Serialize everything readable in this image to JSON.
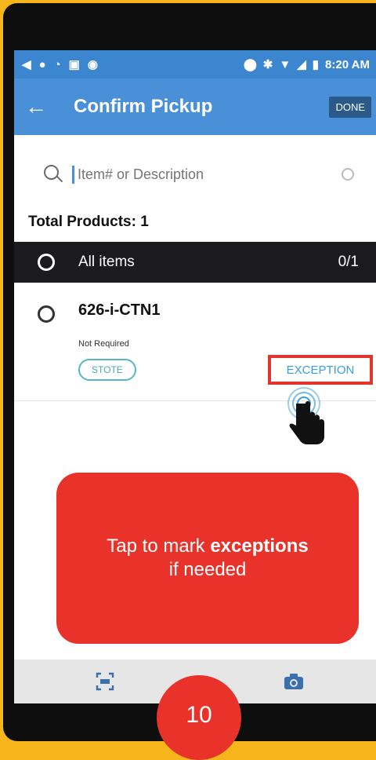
{
  "status_bar": {
    "time": "8:20 AM",
    "left_icons": [
      "back-triangle-icon",
      "circle-icon",
      "wifi-lock-icon",
      "image-icon",
      "sync-icon"
    ],
    "right_icons": [
      "location-pin-icon",
      "bluetooth-icon",
      "wifi-icon",
      "signal-icon",
      "battery-icon"
    ]
  },
  "app_bar": {
    "title": "Confirm Pickup",
    "done_label": "DONE",
    "color": "#4a90d9"
  },
  "search": {
    "placeholder": "Item# or Description"
  },
  "summary": {
    "total_products": "Total Products: 1"
  },
  "all_items": {
    "label": "All items",
    "count": "0/1"
  },
  "items": [
    {
      "id": "626-i-CTN1",
      "status": "Not Required",
      "chip": "STOTE",
      "action": "EXCEPTION"
    }
  ],
  "tooltip": {
    "text_prefix": "Tap to mark ",
    "text_bold": "exceptions",
    "text_suffix": "if needed",
    "color": "#e8322a"
  },
  "bottom_bar": {
    "icons": [
      "scan-icon",
      "camera-icon"
    ]
  },
  "step_number": "10",
  "colors": {
    "frame": "#f5b51b",
    "accent": "#4a90d9",
    "highlight": "#e8322a",
    "chip": "#55b8c6"
  }
}
